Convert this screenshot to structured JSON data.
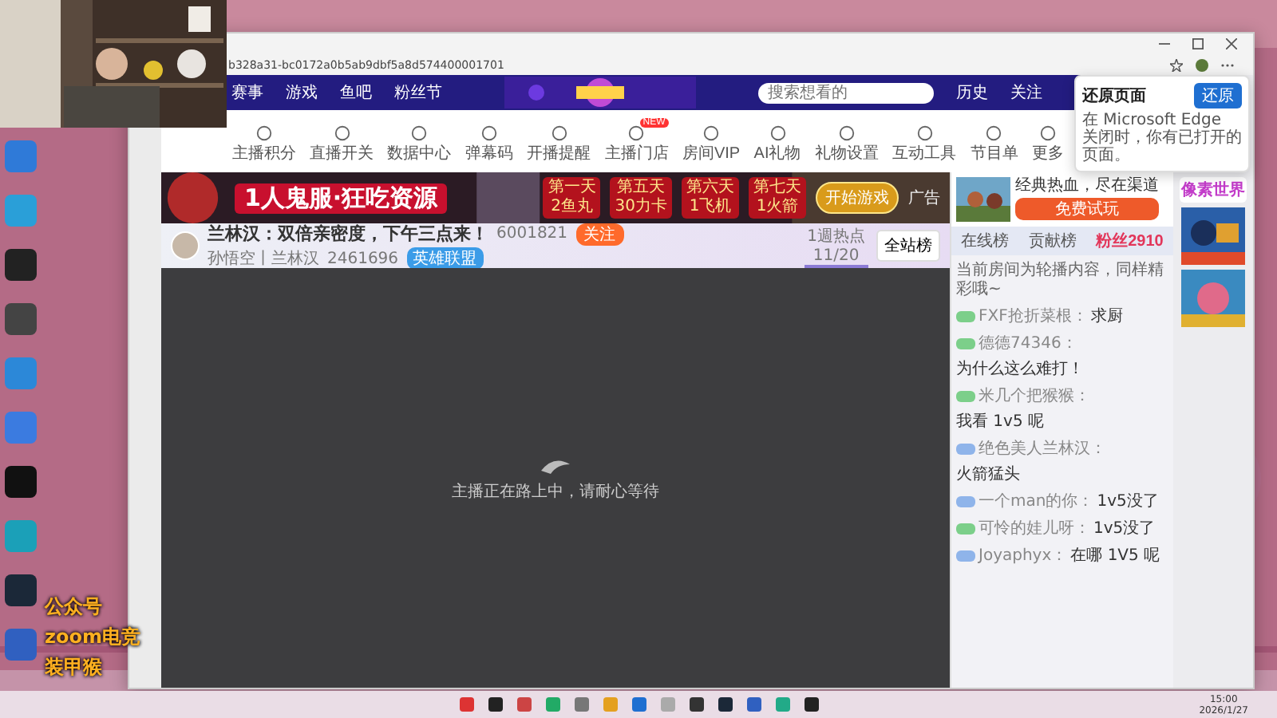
{
  "browser": {
    "url": "b328a31-bc0172a0b5ab9dbf5a8d574400001701"
  },
  "site_nav": {
    "links": [
      "赛事",
      "游戏",
      "鱼吧",
      "粉丝节"
    ],
    "search": {
      "placeholder": "搜索想看的"
    },
    "actions": [
      "历史",
      "关注"
    ]
  },
  "toolbar": [
    {
      "label": "主播积分"
    },
    {
      "label": "直播开关"
    },
    {
      "label": "数据中心"
    },
    {
      "label": "弹幕码"
    },
    {
      "label": "开播提醒"
    },
    {
      "label": "主播门店",
      "badge": "NEW"
    },
    {
      "label": "房间VIP"
    },
    {
      "label": "AI礼物"
    },
    {
      "label": "礼物设置"
    },
    {
      "label": "互动工具"
    },
    {
      "label": "节目单"
    },
    {
      "label": "更多"
    }
  ],
  "banner": {
    "title": "1人鬼服·狂吃资源",
    "days": [
      {
        "day": "第一天",
        "reward": "2鱼丸"
      },
      {
        "day": "第五天",
        "reward": "30力卡"
      },
      {
        "day": "第六天",
        "reward": "1飞机"
      },
      {
        "day": "第七天",
        "reward": "1火箭"
      }
    ],
    "cta": "开始游戏",
    "ad_label": "广告"
  },
  "room": {
    "title": "兰林汉：双倍亲密度，下午三点来！",
    "room_id": "6001821",
    "follow": "关注",
    "anchor": "孙悟空丨兰林汉",
    "popularity": "2461696",
    "category": "英雄联盟",
    "rank_label": "1週热点",
    "rank_value": "11/20",
    "board": "全站榜"
  },
  "player": {
    "message": "主播正在路上中，请耐心等待"
  },
  "side_ad": {
    "title": "经典热血，尽在渠道",
    "button": "免费试玩"
  },
  "chat_tabs": [
    {
      "label": "在线榜",
      "selected": false
    },
    {
      "label": "贡献榜",
      "selected": false
    },
    {
      "label": "粉丝2910",
      "selected": true
    }
  ],
  "chat": [
    {
      "kind": "system",
      "text": "当前房间为轮播内容，同样精彩哦~"
    },
    {
      "kind": "user",
      "color": "#7ccf8a",
      "user": "FXF抢折菜根：",
      "text": "求厨"
    },
    {
      "kind": "user",
      "color": "#7ccf8a",
      "user": "德德74346：",
      "text": "为什么这么难打！"
    },
    {
      "kind": "user",
      "color": "#7ccf8a",
      "user": "米几个把猴猴：",
      "text": "我看 1v5 呢"
    },
    {
      "kind": "user",
      "color": "#8fb4ea",
      "user": "绝色美人兰林汉：",
      "text": "火箭猛头"
    },
    {
      "kind": "user",
      "color": "#8fb4ea",
      "user": "一个man的你：",
      "text": "1v5没了"
    },
    {
      "kind": "user",
      "color": "#7ccf8a",
      "user": "可怜的娃儿呀：",
      "text": "1v5没了"
    },
    {
      "kind": "user",
      "color": "#8fb4ea",
      "user": "Joyaphyx：",
      "text": "在哪 1V5 呢"
    }
  ],
  "right_ad": {
    "title": "像素世界"
  },
  "restore_popup": {
    "title": "还原页面",
    "text": "在 Microsoft Edge 关闭时，你有已打开的页面。",
    "button": "还原"
  },
  "overlay_texts": [
    "公众号",
    "zoom电竞",
    "装甲猴"
  ],
  "clock": {
    "time": "15:00",
    "date": "2026/1/27"
  }
}
